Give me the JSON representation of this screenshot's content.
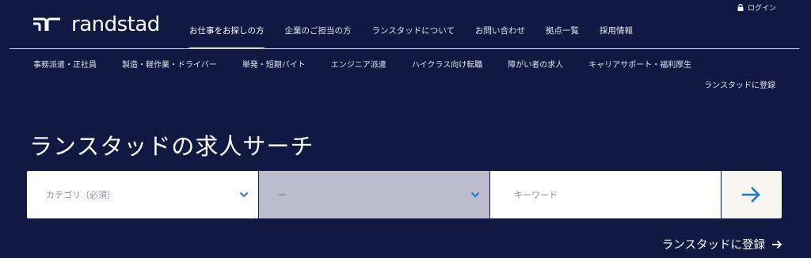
{
  "header": {
    "login_label": "ログイン",
    "brand": "randstad"
  },
  "main_nav": [
    {
      "label": "お仕事をお探しの方",
      "active": true
    },
    {
      "label": "企業のご担当の方"
    },
    {
      "label": "ランスタッドについて"
    },
    {
      "label": "お問い合わせ"
    },
    {
      "label": "拠点一覧"
    },
    {
      "label": "採用情報"
    }
  ],
  "sub_nav": [
    {
      "label": "事務派遣・正社員"
    },
    {
      "label": "製造・軽作業・ドライバー"
    },
    {
      "label": "単発・短期バイト"
    },
    {
      "label": "エンジニア派遣"
    },
    {
      "label": "ハイクラス向け転職"
    },
    {
      "label": "障がい者の求人"
    },
    {
      "label": "キャリアサポート・福利厚生"
    }
  ],
  "sub_register_label": "ランスタッドに登録",
  "search": {
    "title": "ランスタッドの求人サーチ",
    "category_placeholder": "カテゴリ（必須）",
    "sub_category_value": "ー",
    "keyword_placeholder": "キーワード"
  },
  "register_link_label": "ランスタッドに登録",
  "colors": {
    "background": "#0f1941",
    "accent_blue": "#2175d9",
    "disabled_field": "#bcbccb"
  },
  "icons": {
    "login": "lock-icon",
    "chevron": "chevron-down-icon",
    "submit": "arrow-right-icon"
  }
}
